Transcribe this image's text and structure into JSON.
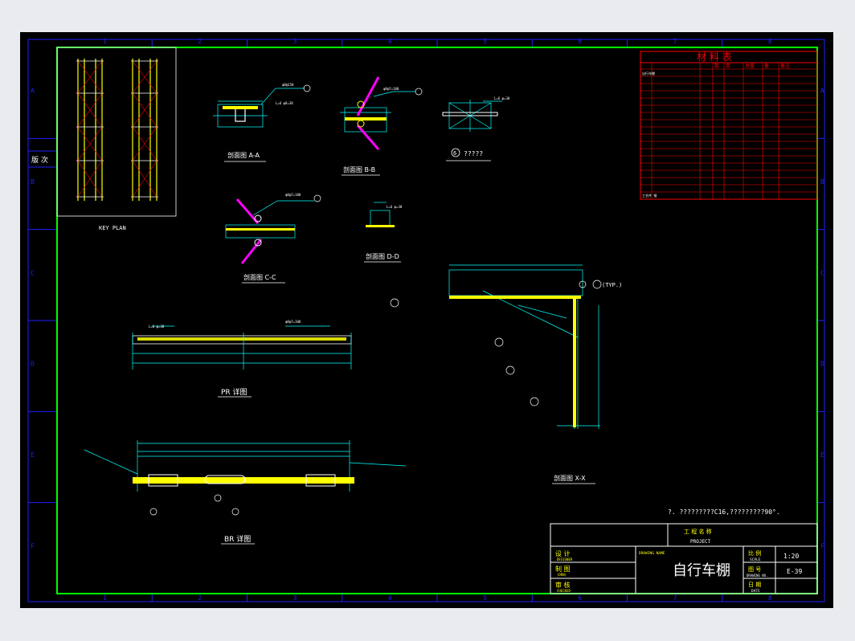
{
  "drawing": {
    "zone_columns": [
      "1",
      "2",
      "3",
      "4",
      "5",
      "6",
      "7",
      "8"
    ],
    "zone_rows": [
      "A",
      "B",
      "C",
      "D",
      "E",
      "F"
    ],
    "frame_tag": "版 次",
    "key_plan_label": "KEY PLAN",
    "sections": {
      "aa": "剖面图 A-A",
      "bb": "剖面图 B-B",
      "cc": "剖面图 C-C",
      "dd": "剖面图 D-D",
      "xx": "剖面图 X-X",
      "node": "?????",
      "node_no": "6",
      "pr": "PR 详图",
      "br": "BR 详图",
      "typ": "(TYP.)"
    },
    "note": "?. ?????????C16,?????????90°.",
    "material_table": {
      "title": "材 料 表",
      "headers": [
        "",
        "",
        "数",
        "单",
        "总重",
        "备",
        "备注"
      ],
      "first_row": "自行车棚",
      "last_row": "工艺件 钢"
    },
    "title_block": {
      "project_label": "工 程 名 称",
      "project_en": "PROJECT",
      "drawing_name_label": "DRAWING NAME",
      "drawing_name": "自行车棚",
      "scale_label": "比 例",
      "scale_en": "SCALE",
      "scale": "1:20",
      "drawing_no_label": "图 号",
      "drawing_no_en": "DRAWING NO.",
      "drawing_no": "E-39",
      "date_label": "日 期",
      "date_en": "DATE",
      "designer_label": "设 计",
      "designer_en": "DESIGNER",
      "drawer_label": "制 图",
      "drawer_en": "(DRW)",
      "checker_label": "审 核",
      "checker_en": "CHECKED"
    }
  },
  "colors": {
    "background": "#000000",
    "frame": "#00ff00",
    "grid": "#2020ff",
    "lines": "#ffffff",
    "dims": "#00ffff",
    "steel": "#ffff00",
    "brace": "#ff00ff",
    "table": "#ff0000"
  }
}
